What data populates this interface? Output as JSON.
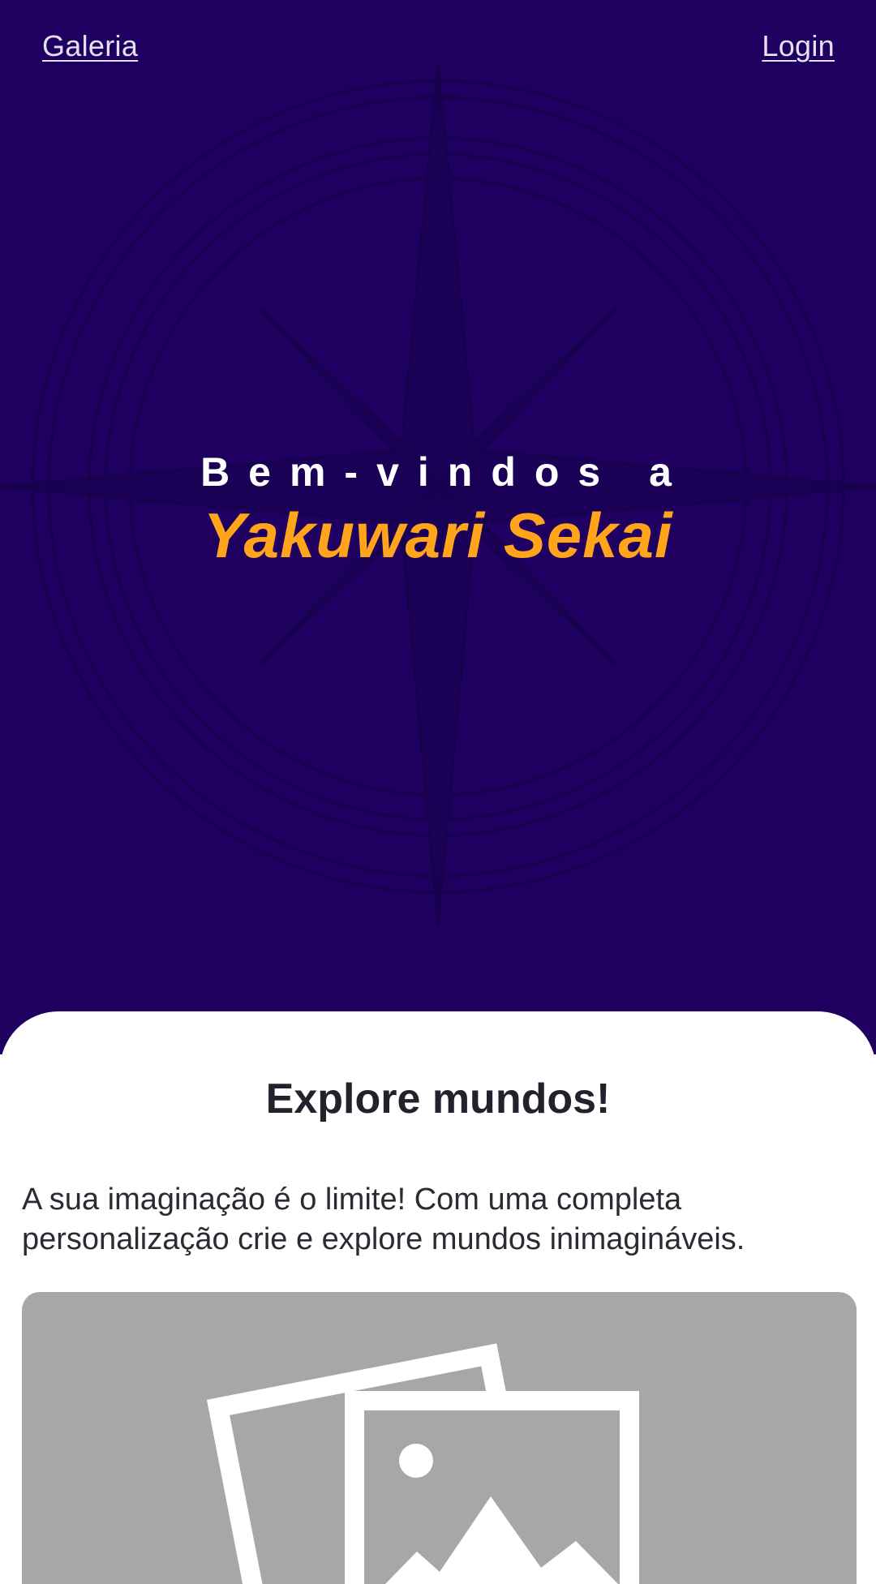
{
  "header": {
    "left_link": "Galeria",
    "right_link": "Login"
  },
  "hero": {
    "welcome": "Bem-vindos a",
    "brand": "Yakuwari Sekai",
    "background_icon": "compass-rose-icon"
  },
  "section": {
    "title": "Explore mundos!",
    "description": "A sua imaginação é o limite! Com uma completa personalização crie e explore mundos inimagináveis.",
    "image_icon": "image-placeholder-icon"
  },
  "colors": {
    "hero_background": "#1f0060",
    "brand_accent": "#ffa41b",
    "placeholder_gray": "#a7a7a7"
  }
}
